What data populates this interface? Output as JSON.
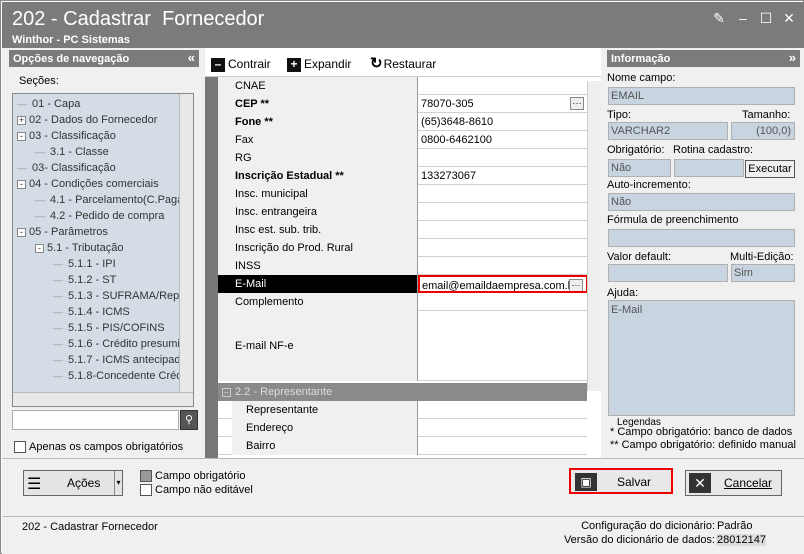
{
  "window": {
    "title": "202 - Cadastrar  Fornecedor",
    "subtitle": "Winthor - PC Sistemas"
  },
  "nav": {
    "header": "Opções de navegação",
    "sections_label": "Seções:",
    "search_placeholder": "",
    "only_required": "Apenas os campos obrigatórios",
    "tree": [
      {
        "label": "01 - Capa",
        "level": 0,
        "toggle": ""
      },
      {
        "label": "02 - Dados do Fornecedor",
        "level": 0,
        "toggle": "+"
      },
      {
        "label": "03 - Classificação",
        "level": 0,
        "toggle": "-"
      },
      {
        "label": "3.1 - Classe",
        "level": 1,
        "toggle": ""
      },
      {
        "label": "03- Classificação",
        "level": 0,
        "toggle": ""
      },
      {
        "label": "04 - Condições comerciais",
        "level": 0,
        "toggle": "-"
      },
      {
        "label": "4.1 - Parcelamento(C.Paga",
        "level": 1,
        "toggle": ""
      },
      {
        "label": "4.2 - Pedido de compra",
        "level": 1,
        "toggle": ""
      },
      {
        "label": "05 - Parâmetros",
        "level": 0,
        "toggle": "-"
      },
      {
        "label": "5.1 - Tributação",
        "level": 1,
        "toggle": "-"
      },
      {
        "label": "5.1.1 - IPI",
        "level": 2,
        "toggle": ""
      },
      {
        "label": "5.1.2 - ST",
        "level": 2,
        "toggle": ""
      },
      {
        "label": "5.1.3 - SUFRAMA/Repa",
        "level": 2,
        "toggle": ""
      },
      {
        "label": "5.1.4 - ICMS",
        "level": 2,
        "toggle": ""
      },
      {
        "label": "5.1.5 - PIS/COFINS",
        "level": 2,
        "toggle": ""
      },
      {
        "label": "5.1.6 - Crédito presumi",
        "level": 2,
        "toggle": ""
      },
      {
        "label": "5.1.7 - ICMS antecipad",
        "level": 2,
        "toggle": ""
      },
      {
        "label": "5.1.8-Concedente Créd",
        "level": 2,
        "toggle": ""
      }
    ]
  },
  "toolbar": {
    "collapse": "Contrair",
    "expand": "Expandir",
    "restore": "Restaurar"
  },
  "grid": {
    "rows": [
      {
        "label": "CNAE",
        "value": "",
        "bold": false
      },
      {
        "label": "CEP **",
        "value": "78070-305",
        "bold": true,
        "ellipsis": true
      },
      {
        "label": "Fone **",
        "value": "(65)3648-8610",
        "bold": true
      },
      {
        "label": "Fax",
        "value": "0800-6462100",
        "bold": false
      },
      {
        "label": "RG",
        "value": "",
        "bold": false
      },
      {
        "label": "Inscrição Estadual **",
        "value": "133273067",
        "bold": true
      },
      {
        "label": "Insc. municipal",
        "value": "",
        "bold": false
      },
      {
        "label": "Insc. entrangeira",
        "value": "",
        "bold": false
      },
      {
        "label": "Insc est. sub. trib.",
        "value": "",
        "bold": false
      },
      {
        "label": "Inscrição do Prod. Rural",
        "value": "",
        "bold": false
      },
      {
        "label": "INSS",
        "value": "",
        "bold": false
      },
      {
        "label": "E-Mail",
        "value": "email@emaildaempresa.com.br",
        "bold": false,
        "selected": true
      },
      {
        "label": "Complemento",
        "value": "",
        "bold": false
      },
      {
        "label": "E-mail NF-e",
        "value": "",
        "bold": false
      }
    ],
    "group": "2.2 - Representante",
    "subrows": [
      {
        "label": "Representante",
        "value": ""
      },
      {
        "label": "Endereço",
        "value": ""
      },
      {
        "label": "Bairro",
        "value": ""
      }
    ]
  },
  "info": {
    "header": "Informação",
    "field_name_label": "Nome campo:",
    "field_name": "EMAIL",
    "type_label": "Tipo:",
    "size_label": "Tamanho:",
    "type": "VARCHAR2",
    "size": "(100,0)",
    "required_label": "Obrigatório:",
    "routine_label": "Rotina cadastro:",
    "required": "Não",
    "execute": "Executar",
    "autoinc_label": "Auto-incremento:",
    "autoinc": "Não",
    "formula_label": "Fórmula de preenchimento",
    "default_label": "Valor default:",
    "multi_label": "Multi-Edição:",
    "multi": "Sim",
    "help_label": "Ajuda:",
    "help": "E-Mail",
    "legend_title": "Legendas",
    "legend1": "* Campo obrigatório: banco de dados",
    "legend2": "** Campo obrigatório: definido manual"
  },
  "bottom": {
    "actions": "Ações",
    "mandatory": "Campo obrigatório",
    "noneditable": "Campo não editável",
    "save": "Salvar",
    "cancel": "Cancelar"
  },
  "status": {
    "left": "202 - Cadastrar  Fornecedor",
    "dict_config_label": "Configuração do dicionário:",
    "dict_config": "Padrão",
    "dict_version_label": "Versão do dicionário de dados:",
    "dict_version": "28012147"
  }
}
